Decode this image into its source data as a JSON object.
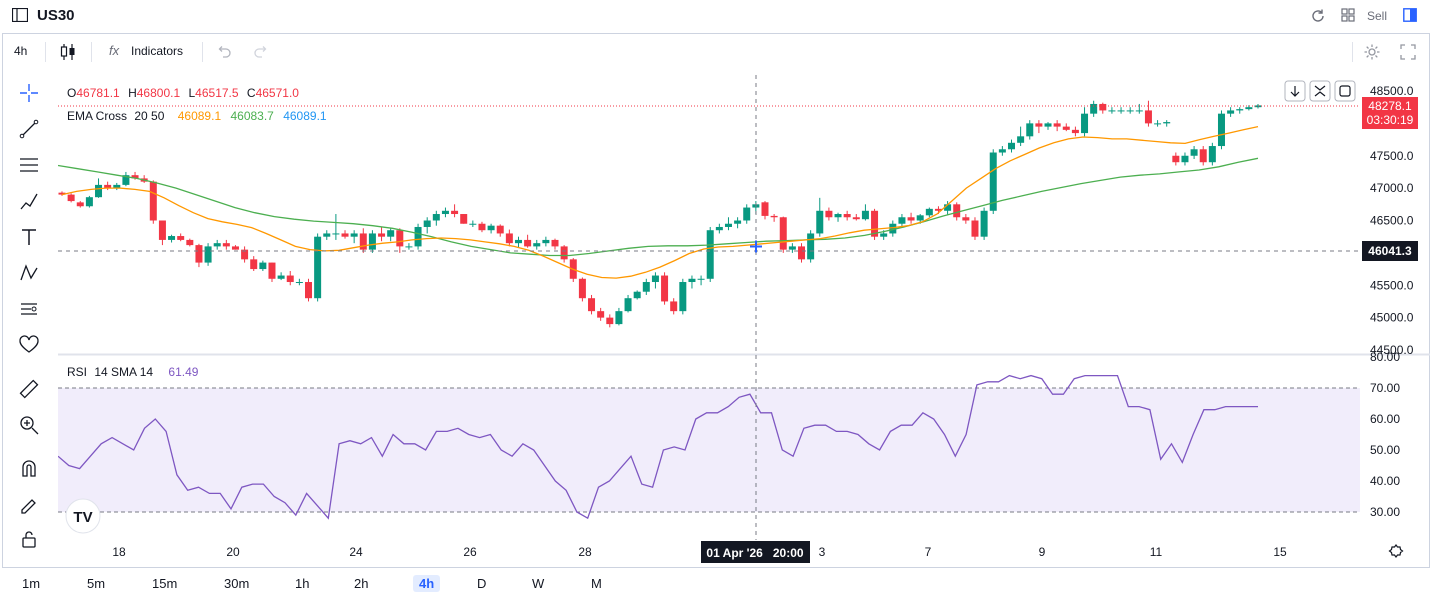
{
  "window": {
    "title": "US30",
    "sell_label": "Sell"
  },
  "toolbar": {
    "interval": "4h",
    "indicators_label": "Indicators"
  },
  "legend": {
    "o_label": "O",
    "o_value": "46781.1",
    "h_label": "H",
    "h_value": "46800.1",
    "l_label": "L",
    "l_value": "46517.5",
    "c_label": "C",
    "c_value": "46571.0",
    "ema_name": "EMA Cross",
    "ema_params": "20 50",
    "ema_v1": "46089.1",
    "ema_v2": "46083.7",
    "ema_v3": "46089.1",
    "rsi_name": "RSI",
    "rsi_params": "14 SMA 14",
    "rsi_value": "61.49"
  },
  "price_scale": {
    "ticks": [
      "48500.0",
      "48000.0",
      "47500.0",
      "47000.0",
      "46500.0",
      "46000.0",
      "45500.0",
      "45000.0",
      "44500.0"
    ],
    "last_price": "48278.1",
    "countdown": "03:30:19",
    "crosshair_price": "46041.3"
  },
  "rsi_scale": {
    "ticks": [
      "80.00",
      "70.00",
      "60.00",
      "50.00",
      "40.00",
      "30.00"
    ]
  },
  "time_axis": {
    "labels": [
      "18",
      "20",
      "24",
      "26",
      "28",
      "3",
      "7",
      "9",
      "11",
      "15"
    ],
    "crosshair_label": "01 Apr '26   20:00"
  },
  "timeframes": [
    "1m",
    "5m",
    "15m",
    "30m",
    "1h",
    "2h",
    "4h",
    "D",
    "W",
    "M"
  ],
  "active_timeframe": "4h",
  "colors": {
    "up": "#089981",
    "down": "#f23645",
    "ema_fast": "#ff9800",
    "ema_slow": "#4caf50",
    "rsi": "#7e57c2",
    "accent": "#2962ff"
  },
  "chart_data": {
    "type": "candlestick",
    "y_range": [
      44500,
      48700
    ],
    "candles": [
      [
        46930,
        46950,
        46880,
        46900
      ],
      [
        46900,
        46920,
        46780,
        46800
      ],
      [
        46780,
        46800,
        46700,
        46720
      ],
      [
        46720,
        46880,
        46700,
        46860
      ],
      [
        46860,
        47150,
        46850,
        47050
      ],
      [
        47050,
        47100,
        46970,
        47000
      ],
      [
        47000,
        47080,
        46970,
        47050
      ],
      [
        47050,
        47250,
        47030,
        47200
      ],
      [
        47200,
        47250,
        47130,
        47150
      ],
      [
        47150,
        47200,
        47080,
        47100
      ],
      [
        47100,
        47120,
        46450,
        46500
      ],
      [
        46500,
        46500,
        46120,
        46200
      ],
      [
        46200,
        46280,
        46160,
        46260
      ],
      [
        46260,
        46300,
        46180,
        46200
      ],
      [
        46200,
        46220,
        46100,
        46120
      ],
      [
        46120,
        46140,
        45780,
        45850
      ],
      [
        45850,
        46150,
        45800,
        46100
      ],
      [
        46100,
        46200,
        46050,
        46150
      ],
      [
        46150,
        46200,
        46050,
        46100
      ],
      [
        46100,
        46120,
        46050,
        46050
      ],
      [
        46050,
        46100,
        45850,
        45900
      ],
      [
        45900,
        45950,
        45720,
        45750
      ],
      [
        45750,
        45880,
        45720,
        45850
      ],
      [
        45850,
        45850,
        45550,
        45600
      ],
      [
        45600,
        45700,
        45580,
        45650
      ],
      [
        45650,
        45720,
        45500,
        45550
      ],
      [
        45550,
        45600,
        45500,
        45550
      ],
      [
        45550,
        45600,
        45250,
        45300
      ],
      [
        45300,
        46300,
        45250,
        46250
      ],
      [
        46250,
        46350,
        46200,
        46300
      ],
      [
        46300,
        46600,
        46200,
        46300
      ],
      [
        46300,
        46350,
        46220,
        46250
      ],
      [
        46250,
        46350,
        46150,
        46300
      ],
      [
        46300,
        46380,
        46000,
        46050
      ],
      [
        46050,
        46350,
        46000,
        46300
      ],
      [
        46300,
        46400,
        46180,
        46250
      ],
      [
        46250,
        46380,
        46180,
        46350
      ],
      [
        46350,
        46380,
        46000,
        46100
      ],
      [
        46100,
        46150,
        46050,
        46100
      ],
      [
        46100,
        46450,
        46050,
        46400
      ],
      [
        46400,
        46550,
        46300,
        46500
      ],
      [
        46500,
        46650,
        46420,
        46600
      ],
      [
        46600,
        46700,
        46550,
        46650
      ],
      [
        46650,
        46750,
        46550,
        46600
      ],
      [
        46600,
        46600,
        46450,
        46450
      ],
      [
        46450,
        46500,
        46400,
        46450
      ],
      [
        46450,
        46480,
        46320,
        46350
      ],
      [
        46350,
        46450,
        46300,
        46420
      ],
      [
        46420,
        46440,
        46250,
        46300
      ],
      [
        46300,
        46360,
        46100,
        46150
      ],
      [
        46150,
        46250,
        46080,
        46200
      ],
      [
        46200,
        46280,
        46080,
        46100
      ],
      [
        46100,
        46200,
        46050,
        46150
      ],
      [
        46150,
        46250,
        46100,
        46200
      ],
      [
        46200,
        46220,
        46050,
        46100
      ],
      [
        46100,
        46120,
        45850,
        45900
      ],
      [
        45900,
        45920,
        45550,
        45600
      ],
      [
        45600,
        45620,
        45250,
        45300
      ],
      [
        45300,
        45350,
        45050,
        45100
      ],
      [
        45100,
        45150,
        44950,
        45000
      ],
      [
        45000,
        45050,
        44850,
        44900
      ],
      [
        44900,
        45150,
        44880,
        45100
      ],
      [
        45100,
        45350,
        45080,
        45300
      ],
      [
        45300,
        45420,
        45280,
        45400
      ],
      [
        45400,
        45600,
        45350,
        45550
      ],
      [
        45550,
        45700,
        45450,
        45650
      ],
      [
        45650,
        45700,
        45200,
        45250
      ],
      [
        45250,
        45300,
        45050,
        45100
      ],
      [
        45100,
        45600,
        45050,
        45550
      ],
      [
        45550,
        45650,
        45450,
        45600
      ],
      [
        45600,
        45650,
        45500,
        45600
      ],
      [
        45600,
        46400,
        45550,
        46350
      ],
      [
        46350,
        46450,
        46300,
        46400
      ],
      [
        46400,
        46550,
        46350,
        46450
      ],
      [
        46450,
        46550,
        46380,
        46500
      ],
      [
        46500,
        46750,
        46450,
        46700
      ],
      [
        46700,
        46800,
        46600,
        46750
      ],
      [
        46781,
        46800,
        46517,
        46571
      ],
      [
        46571,
        46600,
        46480,
        46550
      ],
      [
        46550,
        46560,
        46000,
        46050
      ],
      [
        46050,
        46150,
        46000,
        46100
      ],
      [
        46100,
        46150,
        45850,
        45900
      ],
      [
        45900,
        46350,
        45850,
        46300
      ],
      [
        46300,
        46850,
        46250,
        46650
      ],
      [
        46650,
        46700,
        46500,
        46550
      ],
      [
        46550,
        46620,
        46480,
        46600
      ],
      [
        46600,
        46650,
        46500,
        46550
      ],
      [
        46550,
        46600,
        46500,
        46520
      ],
      [
        46520,
        46750,
        46500,
        46650
      ],
      [
        46650,
        46680,
        46200,
        46250
      ],
      [
        46250,
        46350,
        46200,
        46300
      ],
      [
        46300,
        46500,
        46250,
        46450
      ],
      [
        46450,
        46600,
        46400,
        46550
      ],
      [
        46550,
        46620,
        46450,
        46500
      ],
      [
        46500,
        46600,
        46450,
        46580
      ],
      [
        46580,
        46700,
        46550,
        46680
      ],
      [
        46680,
        46720,
        46600,
        46650
      ],
      [
        46650,
        46800,
        46580,
        46750
      ],
      [
        46750,
        46780,
        46500,
        46550
      ],
      [
        46550,
        46600,
        46450,
        46500
      ],
      [
        46500,
        46550,
        46200,
        46250
      ],
      [
        46250,
        46700,
        46200,
        46650
      ],
      [
        46650,
        47600,
        46600,
        47550
      ],
      [
        47550,
        47650,
        47500,
        47600
      ],
      [
        47600,
        47750,
        47550,
        47700
      ],
      [
        47700,
        47950,
        47650,
        47800
      ],
      [
        47800,
        48050,
        47750,
        48000
      ],
      [
        48000,
        48050,
        47850,
        47950
      ],
      [
        47950,
        48020,
        47900,
        48000
      ],
      [
        48000,
        48050,
        47880,
        47950
      ],
      [
        47950,
        48000,
        47880,
        47900
      ],
      [
        47900,
        47950,
        47800,
        47850
      ],
      [
        47850,
        48250,
        47800,
        48150
      ],
      [
        48150,
        48350,
        48100,
        48300
      ],
      [
        48300,
        48320,
        48150,
        48200
      ],
      [
        48200,
        48250,
        48150,
        48200
      ],
      [
        48200,
        48250,
        48150,
        48200
      ],
      [
        48200,
        48250,
        48150,
        48200
      ],
      [
        48200,
        48300,
        48150,
        48200
      ],
      [
        48200,
        48350,
        47950,
        48000
      ],
      [
        48000,
        48050,
        47950,
        48000
      ],
      [
        48000,
        48050,
        47950,
        48020
      ],
      [
        47500,
        47550,
        47350,
        47400
      ],
      [
        47400,
        47550,
        47350,
        47500
      ],
      [
        47500,
        47650,
        47450,
        47600
      ],
      [
        47600,
        47650,
        47350,
        47400
      ],
      [
        47400,
        47700,
        47350,
        47650
      ],
      [
        47650,
        48200,
        47600,
        48150
      ],
      [
        48150,
        48250,
        48100,
        48200
      ],
      [
        48200,
        48250,
        48150,
        48220
      ],
      [
        48220,
        48280,
        48200,
        48250
      ],
      [
        48250,
        48300,
        48230,
        48278
      ]
    ],
    "ema_fast": [
      46900,
      46950,
      46980,
      47000,
      47000,
      46980,
      46950,
      46850,
      46730,
      46620,
      46530,
      46480,
      46440,
      46390,
      46300,
      46200,
      46100,
      46050,
      46030,
      46040,
      46080,
      46120,
      46150,
      46170,
      46200,
      46220,
      46230,
      46220,
      46200,
      46170,
      46140,
      46100,
      46040,
      45950,
      45850,
      45750,
      45670,
      45620,
      45610,
      45640,
      45700,
      45780,
      45880,
      45990,
      46060,
      46090,
      46100,
      46120,
      46140,
      46160,
      46180,
      46200,
      46220,
      46260,
      46310,
      46350,
      46370,
      46390,
      46420,
      46480,
      46600,
      46800,
      47000,
      47150,
      47300,
      47420,
      47520,
      47620,
      47700,
      47760,
      47790,
      47780,
      47760,
      47760,
      47740,
      47720,
      47700,
      47690,
      47750,
      47800,
      47850,
      47900,
      47950
    ],
    "ema_slow": [
      47350,
      47300,
      47250,
      47200,
      47150,
      47080,
      47000,
      46900,
      46800,
      46700,
      46620,
      46560,
      46520,
      46490,
      46470,
      46450,
      46420,
      46380,
      46320,
      46250,
      46170,
      46100,
      46050,
      46000,
      45980,
      45960,
      45960,
      45990,
      46030,
      46070,
      46100,
      46110,
      46110,
      46120,
      46140,
      46160,
      46180,
      46190,
      46200,
      46210,
      46230,
      46270,
      46330,
      46400,
      46480,
      46570,
      46650,
      46730,
      46810,
      46880,
      46950,
      47010,
      47070,
      47120,
      47170,
      47200,
      47220,
      47250,
      47280,
      47330,
      47400,
      47460
    ],
    "rsi": [
      48,
      45,
      44,
      48,
      52,
      54,
      52,
      50,
      57,
      60,
      56,
      42,
      37,
      38,
      36,
      36,
      31,
      38,
      39,
      39,
      35,
      33,
      29,
      36,
      32,
      28,
      52,
      53,
      52,
      54,
      48,
      55,
      52,
      52,
      50,
      56,
      56,
      57,
      55,
      54,
      55,
      50,
      48,
      52,
      50,
      45,
      40,
      37,
      30,
      28,
      38,
      40,
      44,
      48,
      39,
      38,
      50,
      51,
      50,
      60,
      62,
      62,
      64,
      67,
      68,
      62,
      62,
      50,
      48,
      57,
      58,
      58,
      56,
      56,
      55,
      52,
      50,
      56,
      58,
      58,
      62,
      60,
      55,
      48,
      55,
      71,
      72,
      72,
      74,
      73,
      74,
      73,
      68,
      68,
      73,
      74,
      74,
      74,
      74,
      64,
      64,
      63,
      47,
      52,
      46,
      55,
      63,
      63,
      64,
      64,
      64,
      64
    ]
  }
}
